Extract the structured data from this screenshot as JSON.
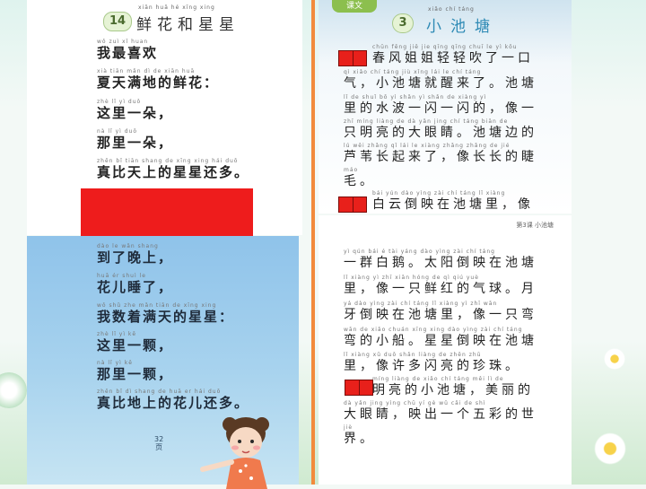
{
  "poem1": {
    "lesson_number": "14",
    "title_pinyin": "xiān huā hé xīng xing",
    "title": "鲜花和星星",
    "lines": [
      {
        "pinyin": "wǒ  zuì  xǐ  huan",
        "text": "我最喜欢"
      },
      {
        "pinyin": "xià tiān mǎn dì  de  xiān huā",
        "text": "夏天满地的鲜花："
      },
      {
        "pinyin": "zhè  lǐ  yì  duǒ",
        "text": "这里一朵，"
      },
      {
        "pinyin": "nà   lǐ  yì  duǒ",
        "text": "那里一朵，"
      },
      {
        "pinyin": "zhēn bǐ tiān shang de xīng xing hái duō",
        "text": "真比天上的星星还多。"
      }
    ],
    "lines_continued": [
      {
        "pinyin": "dào  le  wǎn shang",
        "text": "到了晚上，"
      },
      {
        "pinyin": "huā  ér  shuì  le",
        "text": "花儿睡了，"
      },
      {
        "pinyin": "wǒ  shǔ zhe mǎn tiān de xīng xing",
        "text": "我数着满天的星星："
      },
      {
        "pinyin": "zhè  lǐ  yì  kē",
        "text": "这里一颗，"
      },
      {
        "pinyin": "nà   lǐ  yì  kē",
        "text": "那里一颗，"
      },
      {
        "pinyin": "zhēn bǐ dì shang de huā er hái duō",
        "text": "真比地上的花儿还多。"
      }
    ],
    "caption": "32\n页"
  },
  "lesson2": {
    "tab_label": "课文",
    "lesson_number": "3",
    "title_pinyin": "xiǎo    chí    táng",
    "title": "小池塘",
    "header_right": "第3课  小池塘",
    "lines": [
      {
        "pinyin": "chūn fēng jiě jie qīng qīng chuī le yì kǒu",
        "text": "春风姐姐轻轻吹了一口"
      },
      {
        "pinyin": "qì  xiǎo chí táng jiù xǐng lái le  chí táng",
        "text": "气，小池塘就醒来了。池塘"
      },
      {
        "pinyin": "lǐ  de shuǐ bō  yì shǎn yì shǎn de  xiàng yì",
        "text": "里的水波一闪一闪的，像一"
      },
      {
        "pinyin": "zhī míng liàng de dà yǎn jing chí táng biān de",
        "text": "只明亮的大眼睛。池塘边的"
      },
      {
        "pinyin": "lú wěi zhǎng qǐ lái le xiàng zhǎng zhǎng de jié",
        "text": "芦苇长起来了，像长长的睫"
      },
      {
        "pinyin": "máo",
        "text": "毛。"
      },
      {
        "pinyin": "bái yún dào yìng zài chí táng lǐ  xiàng",
        "text": "白云倒映在池塘里，像"
      },
      {
        "pinyin": "yì qún bái é  tài yáng dào yìng zài chí táng",
        "text": "一群白鹅。太阳倒映在池塘"
      },
      {
        "pinyin": "lǐ  xiàng yì zhī xiān hóng de qì qiú  yuè",
        "text": "里，像一只鲜红的气球。月"
      },
      {
        "pinyin": "yá dào yìng zài chí táng lǐ xiàng yì zhī wān",
        "text": "牙倒映在池塘里，像一只弯"
      },
      {
        "pinyin": "wān de xiǎo chuán xīng xing dào yìng zài chí táng",
        "text": "弯的小船。星星倒映在池塘"
      },
      {
        "pinyin": "lǐ  xiàng xǔ duō shǎn liàng de zhēn zhū",
        "text": "里，像许多闪亮的珍珠。"
      },
      {
        "pinyin": "míng liàng de xiǎo chí táng měi lì de",
        "text": "明亮的小池塘，美丽的"
      },
      {
        "pinyin": "dà yǎn jing yìng chū yí gè wǔ cǎi de shì",
        "text": "大眼睛，映出一个五彩的世"
      },
      {
        "pinyin": "jiè",
        "text": "界。"
      }
    ]
  }
}
